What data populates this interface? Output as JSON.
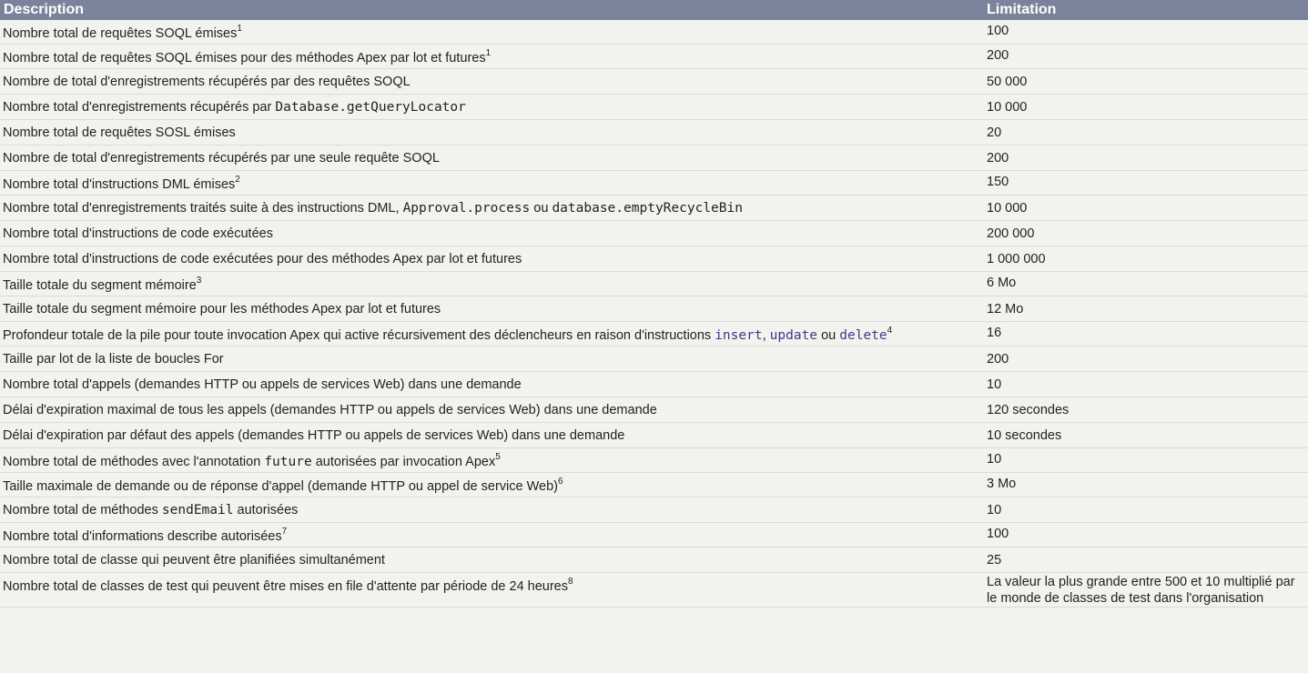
{
  "header": {
    "description": "Description",
    "limitation": "Limitation"
  },
  "rows": [
    {
      "text": "Nombre total de requêtes SOQL émises",
      "sup": "1",
      "value": "100"
    },
    {
      "text": "Nombre total de requêtes SOQL émises pour des méthodes Apex par lot et futures",
      "sup": "1",
      "value": "200"
    },
    {
      "text": "Nombre de total d'enregistrements récupérés par des requêtes SOQL",
      "value": "50 000"
    },
    {
      "text": "Nombre total d'enregistrements récupérés par ",
      "code": "Database.getQueryLocator",
      "value": "10 000"
    },
    {
      "text": "Nombre total de requêtes SOSL émises",
      "value": "20"
    },
    {
      "text": "Nombre de total d'enregistrements récupérés par une seule requête SOQL",
      "value": "200"
    },
    {
      "text": "Nombre total d'instructions DML émises",
      "sup": "2",
      "value": "150"
    },
    {
      "text": "Nombre total d'enregistrements traités suite à des instructions DML, ",
      "code1": "Approval.process",
      "mid": " ou ",
      "code2": "database.emptyRecycleBin",
      "value": "10 000"
    },
    {
      "text": "Nombre total d'instructions de code exécutées",
      "value": "200 000"
    },
    {
      "text": "Nombre total d'instructions de code exécutées pour des méthodes Apex par lot et futures",
      "value": "1 000 000"
    },
    {
      "text": "Taille totale du segment mémoire",
      "sup": "3",
      "value": "6 Mo"
    },
    {
      "text": "Taille totale du segment mémoire pour les méthodes Apex par lot et futures",
      "value": "12 Mo"
    },
    {
      "text": "Profondeur totale de la pile pour toute invocation Apex qui active récursivement des déclencheurs en raison d'instructions ",
      "kw1": "insert",
      "sep1": ", ",
      "kw2": "update",
      "sep2": " ou ",
      "kw3": "delete",
      "sup": "4",
      "value": "16"
    },
    {
      "text": "Taille par lot de la liste de boucles For",
      "value": "200"
    },
    {
      "text": "Nombre total d'appels (demandes HTTP ou appels de services Web) dans une demande",
      "value": "10"
    },
    {
      "text": "Délai d'expiration maximal de tous les appels (demandes HTTP ou appels de services Web) dans une demande",
      "value": "120 secondes"
    },
    {
      "text": "Délai d'expiration par défaut des appels (demandes HTTP ou appels de services Web) dans une demande",
      "value": "10 secondes"
    },
    {
      "text": "Nombre total de méthodes avec l'annotation ",
      "code": "future",
      "after": " autorisées par invocation Apex",
      "sup": "5",
      "value": "10"
    },
    {
      "text": "Taille maximale de demande ou de réponse d'appel (demande HTTP ou appel de service Web)",
      "sup": "6",
      "value": "3 Mo"
    },
    {
      "text": "Nombre total de méthodes ",
      "code": "sendEmail",
      "after": " autorisées",
      "value": "10"
    },
    {
      "text": "Nombre total d'informations describe autorisées",
      "sup": "7",
      "value": "100"
    },
    {
      "text": "Nombre total de classe qui peuvent être planifiées simultanément",
      "value": "25"
    },
    {
      "text": "Nombre total de classes de test qui peuvent être mises en file d'attente par période de 24 heures",
      "sup": "8",
      "value": "La valeur la plus grande entre 500 et 10 multiplié par le monde de classes de test dans l'organisation"
    }
  ]
}
